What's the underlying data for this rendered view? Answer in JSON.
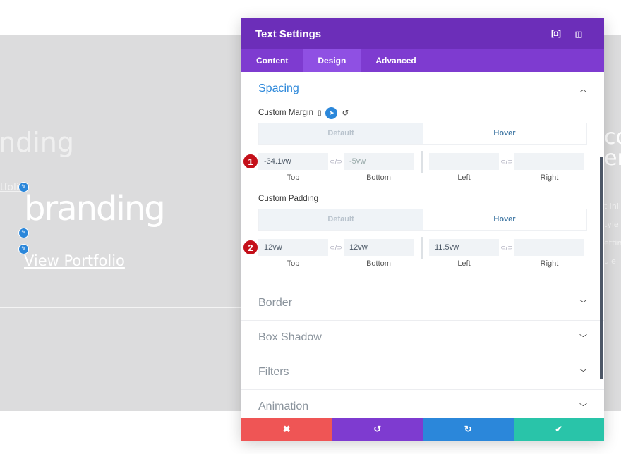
{
  "background": {
    "ghost_heading": "nding",
    "ghost_link": "tfolio",
    "heading": "branding",
    "link": "View Portfolio",
    "right_heading": [
      "co",
      "er"
    ],
    "right_lines": [
      "t inli",
      "tyle c",
      "etting",
      "ule"
    ]
  },
  "modal": {
    "title": "Text Settings",
    "tabs": [
      {
        "label": "Content"
      },
      {
        "label": "Design",
        "active": true
      },
      {
        "label": "Advanced"
      }
    ],
    "section": "Spacing",
    "margin": {
      "label": "Custom Margin",
      "default_label": "Default",
      "hover_label": "Hover",
      "badge": "1",
      "fields": [
        {
          "value": "-34.1vw",
          "caption": "Top"
        },
        {
          "value": "-5vw",
          "caption": "Bottom"
        },
        {
          "value": "",
          "caption": "Left"
        },
        {
          "value": "",
          "caption": "Right"
        }
      ]
    },
    "padding": {
      "label": "Custom Padding",
      "default_label": "Default",
      "hover_label": "Hover",
      "badge": "2",
      "fields": [
        {
          "value": "12vw",
          "caption": "Top"
        },
        {
          "value": "12vw",
          "caption": "Bottom"
        },
        {
          "value": "11.5vw",
          "caption": "Left"
        },
        {
          "value": "",
          "caption": "Right"
        }
      ]
    },
    "collapsed": [
      "Border",
      "Box Shadow",
      "Filters",
      "Animation"
    ]
  },
  "footer": {
    "cancel": "✖",
    "undo": "↺",
    "redo": "↻",
    "save": "✔",
    "colors": {
      "cancel": "#ef5555",
      "undo": "#7e3bd0",
      "redo": "#2b87da",
      "save": "#29c4a9"
    }
  }
}
